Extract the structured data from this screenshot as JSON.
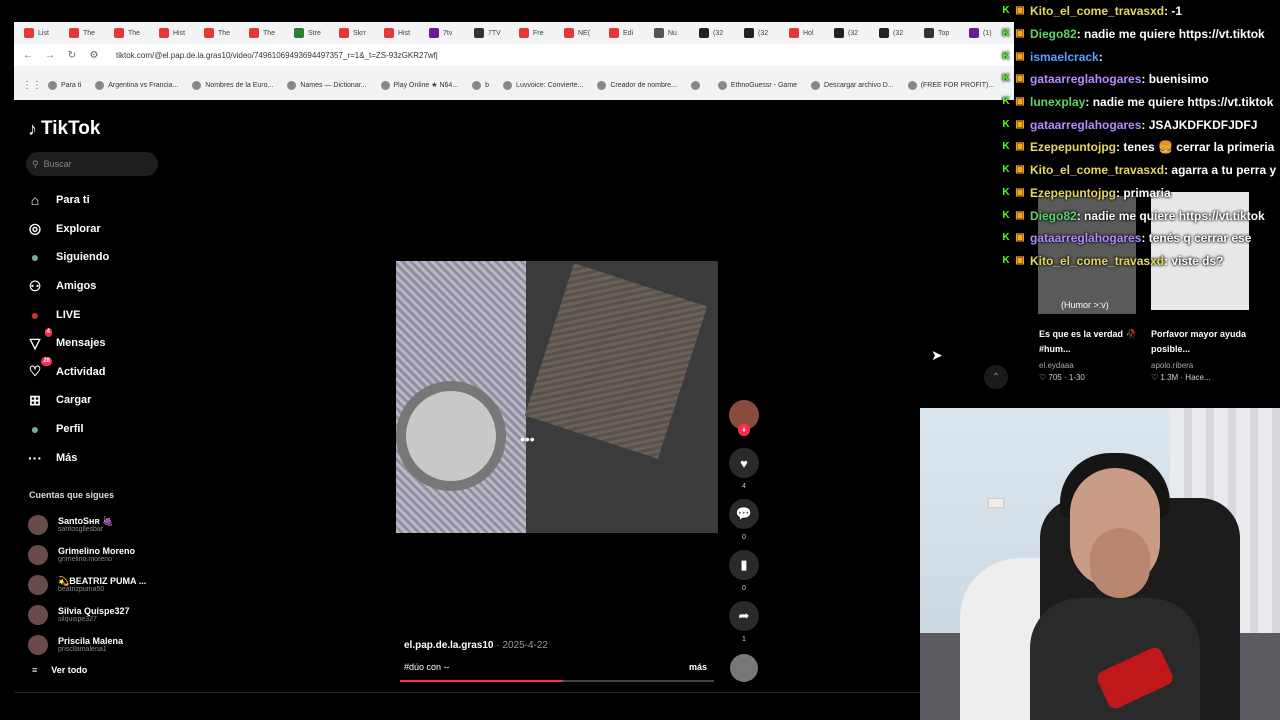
{
  "browser": {
    "tabs": [
      {
        "label": "List",
        "color": "#e53935"
      },
      {
        "label": "The",
        "color": "#e53935"
      },
      {
        "label": "The",
        "color": "#e53935"
      },
      {
        "label": "Hist",
        "color": "#e53935"
      },
      {
        "label": "The",
        "color": "#e53935"
      },
      {
        "label": "The",
        "color": "#e53935"
      },
      {
        "label": "Stre",
        "color": "#2e7d32"
      },
      {
        "label": "Skrr",
        "color": "#e53935"
      },
      {
        "label": "Hist",
        "color": "#e53935"
      },
      {
        "label": "7tv",
        "color": "#6a1b9a"
      },
      {
        "label": "7TV",
        "color": "#333333"
      },
      {
        "label": "Fre",
        "color": "#e53935"
      },
      {
        "label": "NE(",
        "color": "#e53935"
      },
      {
        "label": "Edi",
        "color": "#e53935"
      },
      {
        "label": "Nu",
        "color": "#555555"
      },
      {
        "label": "(32",
        "color": "#222222"
      },
      {
        "label": "(32",
        "color": "#222222"
      },
      {
        "label": "Hol",
        "color": "#e53935"
      },
      {
        "label": "(32",
        "color": "#222222"
      },
      {
        "label": "(32",
        "color": "#222222"
      },
      {
        "label": "Top",
        "color": "#333333"
      },
      {
        "label": "(1)",
        "color": "#6a1b9a"
      }
    ],
    "url": "tiktok.com/@el.pap.de.la.gras10/video/7496106949369449​7357_r=1&_t=ZS-93zGKR27wfj",
    "bookmarks": [
      "Para ti",
      "Argentina vs Francia...",
      "Nombres de la Euro...",
      "Names — Dictionar...",
      "Play Online ★ N64...",
      "b",
      "Luvvoice: Convierte...",
      "Creador de nombre...",
      "",
      "EthnoGuessr - Game",
      "Descargar archivo D...",
      "(FREE FOR PROFIT)..."
    ]
  },
  "tiktok": {
    "logo": "TikTok",
    "search_placeholder": "Buscar",
    "nav": [
      {
        "label": "Para ti",
        "icon": "home-icon",
        "glyph": "⌂"
      },
      {
        "label": "Explorar",
        "icon": "compass-icon",
        "glyph": "◎"
      },
      {
        "label": "Siguiendo",
        "icon": "following-avatar-icon",
        "glyph": "●"
      },
      {
        "label": "Amigos",
        "icon": "friends-icon",
        "glyph": "⚇"
      },
      {
        "label": "LIVE",
        "icon": "live-icon",
        "glyph": "●"
      },
      {
        "label": "Mensajes",
        "icon": "messages-icon",
        "glyph": "▽",
        "badge": "4"
      },
      {
        "label": "Actividad",
        "icon": "activity-icon",
        "glyph": "♡",
        "badge": "28"
      },
      {
        "label": "Cargar",
        "icon": "upload-icon",
        "glyph": "⊞"
      },
      {
        "label": "Perfil",
        "icon": "profile-icon",
        "glyph": "●"
      },
      {
        "label": "Más",
        "icon": "more-icon",
        "glyph": "···"
      }
    ],
    "following_header": "Cuentas que sigues",
    "following": [
      {
        "name": "SantoSʜʀ 🍇",
        "handle": "santosgllesbar"
      },
      {
        "name": "Grimelino Moreno",
        "handle": "grimelino.moreno"
      },
      {
        "name": "💫BEATRIZ PUMA ...",
        "handle": "beatrizpuma50"
      },
      {
        "name": "Silvia Quispe327",
        "handle": "silquispe327"
      },
      {
        "name": "Priscila Malena",
        "handle": "priscilamalena1"
      }
    ],
    "see_all": "Ver todo"
  },
  "video": {
    "username": "el.pap.de.la.gras10",
    "date": " · 2025-4-22",
    "description": "#dúo con --",
    "more": "más",
    "progress": 0.52,
    "likes": "4",
    "comments": "0",
    "saves": "0",
    "shares": "1"
  },
  "suggested": [
    {
      "title": "Es que es la verdad 🥀 #hum...",
      "user": "el.eydaaa",
      "stats": "♡ 705 · 1-30",
      "caption": "(Humor >:v)"
    },
    {
      "title": "Porfavor mayor ayuda posible...",
      "user": "apolo.ribera",
      "stats": "♡ 1.3M · Hace..."
    }
  ],
  "chat": [
    {
      "name": "Kito_el_come_travasxd",
      "text": ": -1",
      "color": "#e6d760"
    },
    {
      "name": "Diego82",
      "text": ": nadie me quiere https://vt.tiktok",
      "color": "#5fd36a"
    },
    {
      "name": "ismaelcrack",
      "text": ":",
      "color": "#5aa0ff"
    },
    {
      "name": "gataarreglahogares",
      "text": ": buenisimo",
      "color": "#b48cff"
    },
    {
      "name": "lunexplay",
      "text": ": nadie me quiere https://vt.tiktok",
      "color": "#5fd36a"
    },
    {
      "name": "gataarreglahogares",
      "text": ": JSAJKDFKDFJDFJ",
      "color": "#b48cff"
    },
    {
      "name": "Ezepepuntojpg",
      "text": ": tenes 🍔 cerrar la primeria",
      "color": "#e6d760"
    },
    {
      "name": "Kito_el_come_travasxd",
      "text": ": agarra a tu perra y",
      "color": "#e6d760"
    },
    {
      "name": "Ezepepuntojpg",
      "text": ": primaria",
      "color": "#e6d760"
    },
    {
      "name": "Diego82",
      "text": ": nadie me quiere https://vt.tiktok",
      "color": "#5fd36a"
    },
    {
      "name": "gataarreglahogares",
      "text": ": tenés q cerrar ese",
      "color": "#b48cff"
    },
    {
      "name": "Kito_el_come_travasxd",
      "text": ": viste ds?",
      "color": "#e6d760"
    }
  ]
}
